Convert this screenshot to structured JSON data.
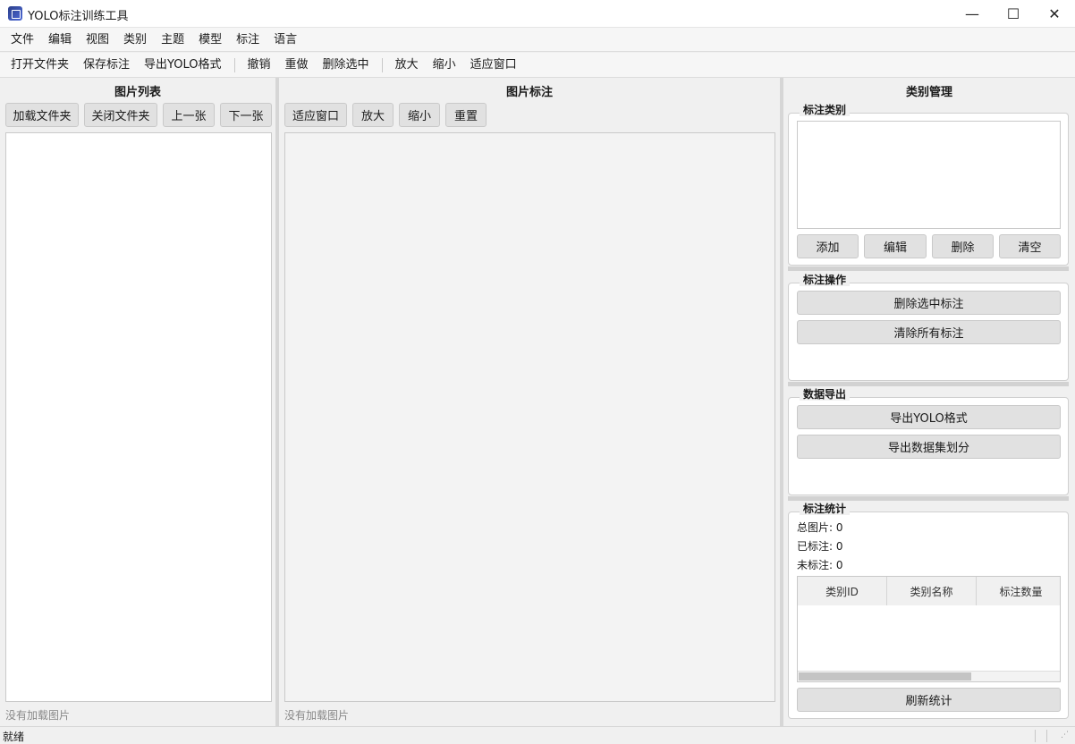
{
  "window": {
    "title": "YOLO标注训练工具",
    "minimize_glyph": "—",
    "maximize_glyph": "☐",
    "close_glyph": "✕"
  },
  "menubar": [
    "文件",
    "编辑",
    "视图",
    "类别",
    "主题",
    "模型",
    "标注",
    "语言"
  ],
  "toolbar": {
    "group1": [
      "打开文件夹",
      "保存标注",
      "导出YOLO格式"
    ],
    "group2": [
      "撤销",
      "重做",
      "删除选中"
    ],
    "group3": [
      "放大",
      "缩小",
      "适应窗口"
    ]
  },
  "left_panel": {
    "title": "图片列表",
    "buttons": [
      "加载文件夹",
      "关闭文件夹",
      "上一张",
      "下一张"
    ],
    "status": "没有加载图片"
  },
  "center_panel": {
    "title": "图片标注",
    "buttons": [
      "适应窗口",
      "放大",
      "缩小",
      "重置"
    ],
    "status": "没有加载图片"
  },
  "right_panel": {
    "title": "类别管理",
    "classes_group": {
      "title": "标注类别",
      "buttons": [
        "添加",
        "编辑",
        "删除",
        "清空"
      ]
    },
    "ops_group": {
      "title": "标注操作",
      "buttons": [
        "删除选中标注",
        "清除所有标注"
      ]
    },
    "export_group": {
      "title": "数据导出",
      "buttons": [
        "导出YOLO格式",
        "导出数据集划分"
      ]
    },
    "stats_group": {
      "title": "标注统计",
      "total": "总图片: 0",
      "labeled": "已标注: 0",
      "unlabeled": "未标注: 0",
      "table_headers": [
        "类别ID",
        "类别名称",
        "标注数量"
      ],
      "refresh": "刷新统计"
    }
  },
  "statusbar": {
    "text": "就绪"
  }
}
